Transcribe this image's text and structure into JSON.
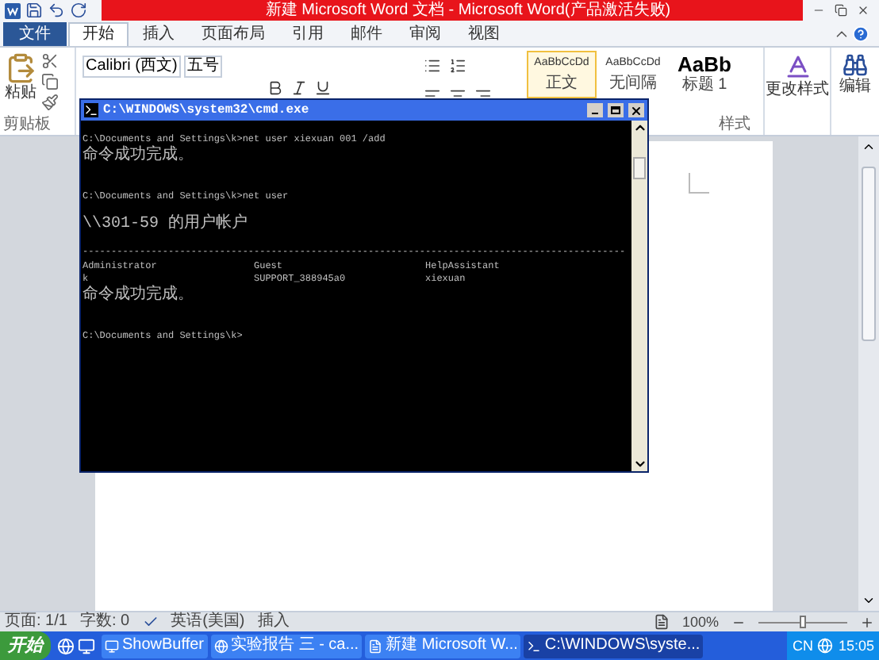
{
  "title_bar": {
    "title": "新建 Microsoft Word 文档 - Microsoft Word(产品激活失败)"
  },
  "tabs": [
    {
      "label": "文件",
      "kind": "file",
      "selected": false
    },
    {
      "label": "开始",
      "kind": "tab",
      "selected": true
    },
    {
      "label": "插入",
      "kind": "tab",
      "selected": false
    },
    {
      "label": "页面布局",
      "kind": "tab",
      "selected": false
    },
    {
      "label": "引用",
      "kind": "tab",
      "selected": false
    },
    {
      "label": "邮件",
      "kind": "tab",
      "selected": false
    },
    {
      "label": "审阅",
      "kind": "tab",
      "selected": false
    },
    {
      "label": "视图",
      "kind": "tab",
      "selected": false
    }
  ],
  "ribbon": {
    "clipboard": {
      "paste": "粘贴",
      "label": "剪贴板"
    },
    "font": {
      "family": "Calibri (西文)",
      "size": "五号"
    },
    "styles": {
      "label": "样式",
      "items": [
        {
          "preview": "AaBbCcDd",
          "name": "正文",
          "selected": true
        },
        {
          "preview": "AaBbCcDd",
          "name": "无间隔",
          "selected": false
        },
        {
          "preview": "AaBb",
          "name": "标题 1",
          "selected": false
        }
      ]
    },
    "change_styles": "更改样式",
    "editing": "编辑"
  },
  "cmd": {
    "title": "C:\\WINDOWS\\system32\\cmd.exe",
    "lines": [
      {
        "kind": "blank"
      },
      {
        "kind": "text",
        "text": "C:\\Documents and Settings\\k>net user xiexuan 001 /add"
      },
      {
        "kind": "text",
        "text": "命令成功完成。"
      },
      {
        "kind": "blank"
      },
      {
        "kind": "blank"
      },
      {
        "kind": "text",
        "text": "C:\\Documents and Settings\\k>net user"
      },
      {
        "kind": "blank"
      },
      {
        "kind": "text",
        "text": "\\\\301-59 的用户帐户"
      },
      {
        "kind": "blank"
      },
      {
        "kind": "text",
        "text": "-----------------------------------------------------------------------------------------------"
      },
      {
        "kind": "columns",
        "cells": [
          "Administrator",
          "Guest",
          "HelpAssistant"
        ]
      },
      {
        "kind": "columns",
        "cells": [
          "k",
          "SUPPORT_388945a0",
          "xiexuan"
        ]
      },
      {
        "kind": "text",
        "text": "命令成功完成。"
      },
      {
        "kind": "blank"
      },
      {
        "kind": "blank"
      },
      {
        "kind": "text",
        "text": "C:\\Documents and Settings\\k>"
      }
    ]
  },
  "status_bar": {
    "page": "页面: 1/1",
    "words": "字数: 0",
    "language": "英语(美国)",
    "mode": "插入",
    "zoom": "100%",
    "zoom_slider": {
      "level": 0.5
    }
  },
  "taskbar": {
    "start": "开始",
    "tasks": [
      {
        "label": "ShowBuffer",
        "kind": "app",
        "selected": false
      },
      {
        "label": "实验报告 三 - ca...",
        "kind": "browser",
        "selected": false
      },
      {
        "label": "新建 Microsoft W...",
        "kind": "word",
        "selected": false
      },
      {
        "label": "C:\\WINDOWS\\syste...",
        "kind": "console",
        "selected": true
      }
    ],
    "language": "CN",
    "clock": "15:05"
  }
}
